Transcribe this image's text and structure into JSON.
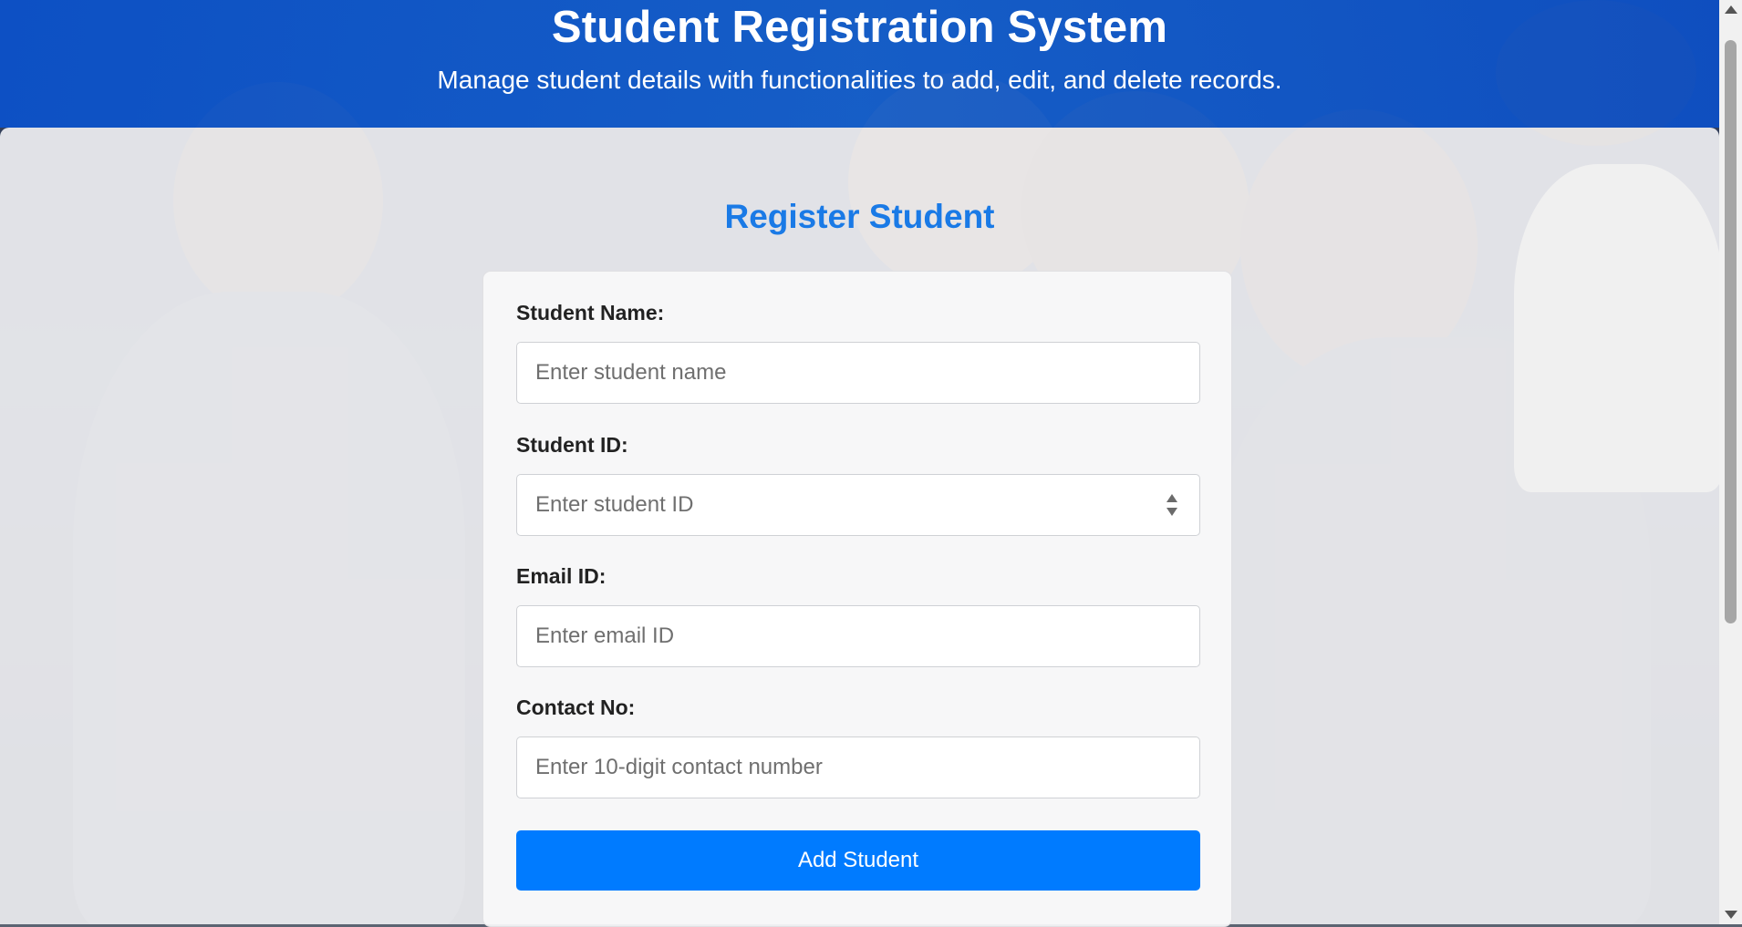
{
  "header": {
    "title": "Student Registration System",
    "subtitle": "Manage student details with functionalities to add, edit, and delete records."
  },
  "form": {
    "heading": "Register Student",
    "name_label": "Student Name:",
    "name_placeholder": "Enter student name",
    "id_label": "Student ID:",
    "id_placeholder": "Enter student ID",
    "email_label": "Email ID:",
    "email_placeholder": "Enter email ID",
    "contact_label": "Contact No:",
    "contact_placeholder": "Enter 10-digit contact number",
    "submit_label": "Add Student"
  },
  "icons": {
    "spinner": "number-spinner-icon",
    "scroll_up": "scroll-up-arrow-icon",
    "scroll_down": "scroll-down-arrow-icon"
  },
  "colors": {
    "header_bg": "#0d5ad0",
    "heading_text": "#1a7ae6",
    "button_bg": "#007bff",
    "button_text": "#ffffff"
  }
}
